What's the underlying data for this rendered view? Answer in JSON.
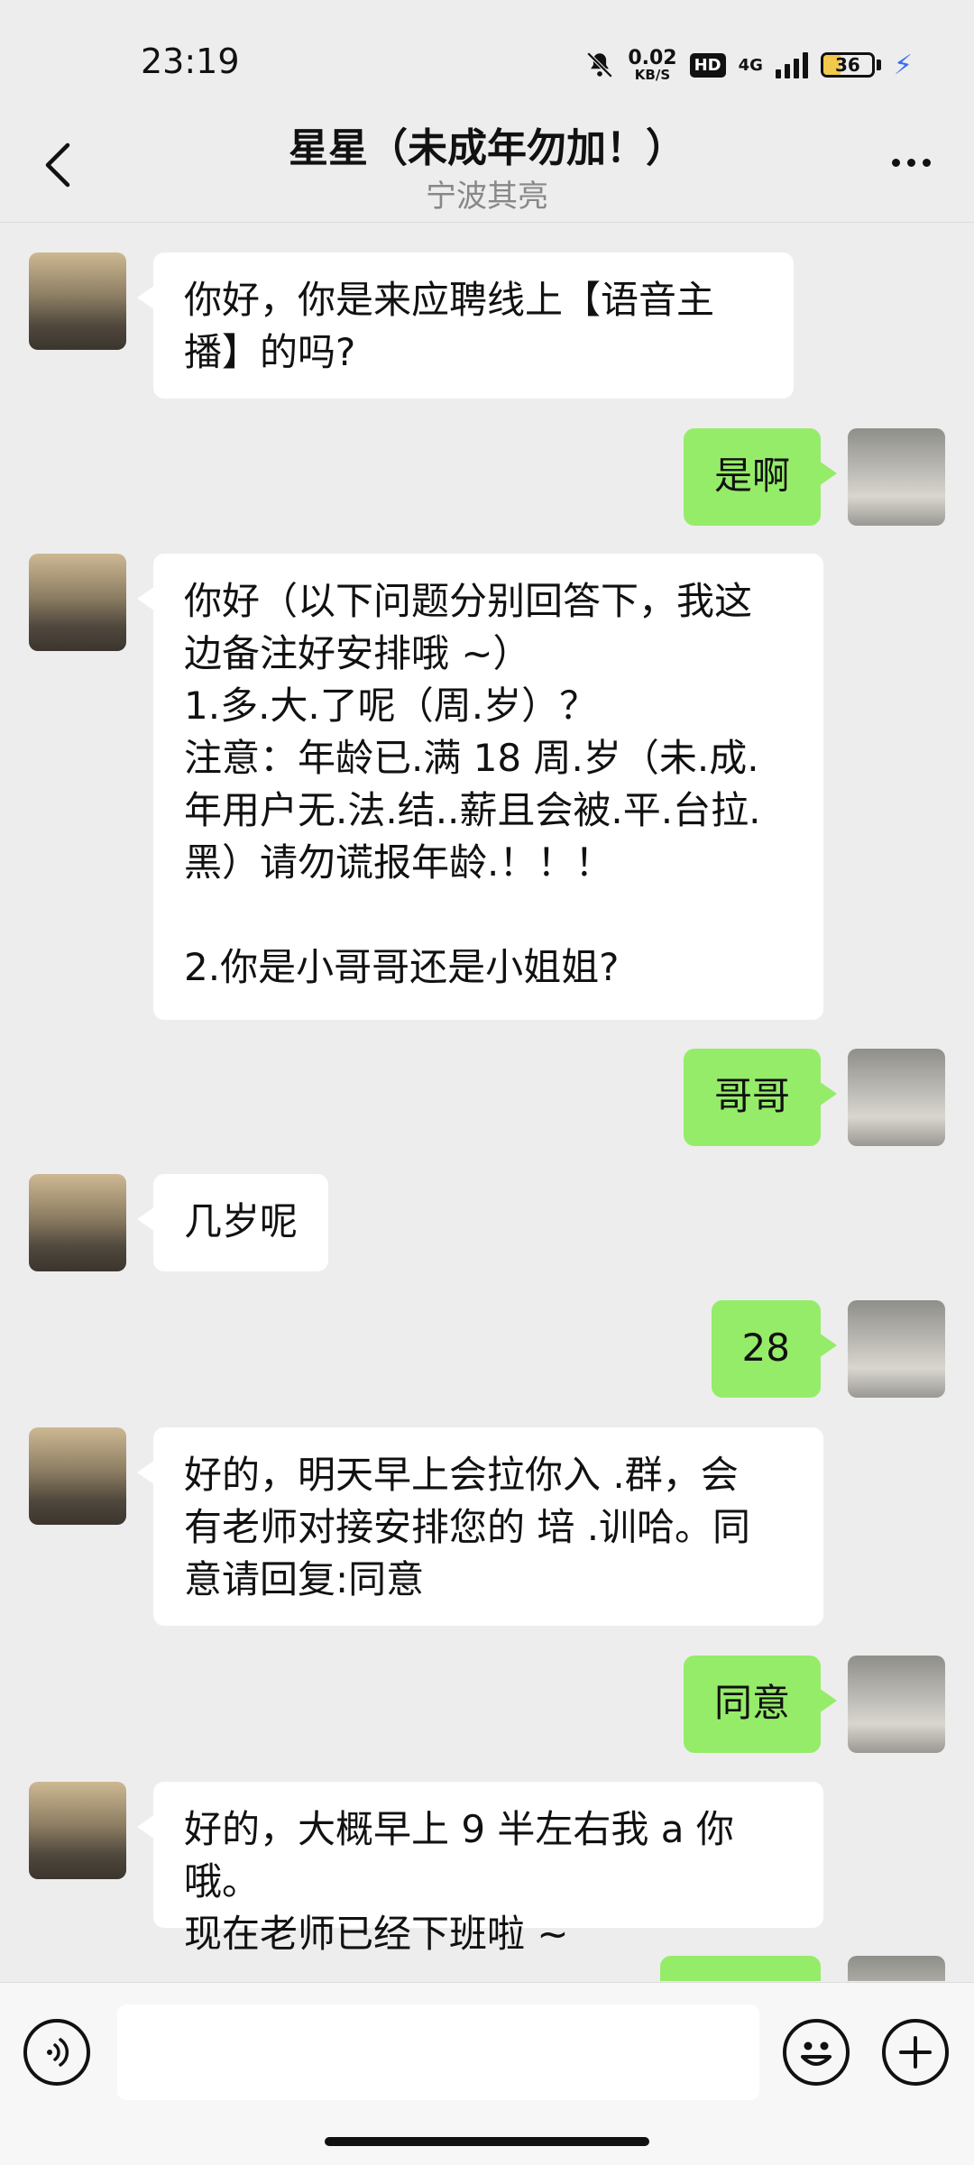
{
  "status_bar": {
    "time": "23:19",
    "net_speed_value": "0.02",
    "net_speed_unit": "KB/S",
    "hd_label": "HD",
    "network_label": "4G",
    "battery_level": "36",
    "icons": [
      "mute-bell-icon",
      "hd-icon",
      "signal-icon",
      "battery-icon",
      "charging-icon"
    ]
  },
  "header": {
    "title": "星星（未成年勿加！）",
    "subtitle": "宁波其亮",
    "back_icon": "chevron-left-icon",
    "more_icon": "more-dots-icon"
  },
  "messages": [
    {
      "side": "left",
      "text": "你好，你是来应聘线上【语音主\n播】的吗?"
    },
    {
      "side": "right",
      "text": "是啊"
    },
    {
      "side": "left",
      "text": "你好（以下问题分别回答下，我这\n边备注好安排哦 ~）\n1.多.大.了呢（周.岁）？\n注意：年龄已.满 18 周.岁（未.成.\n年用户无.法.结..薪且会被.平.台拉.\n黑）请勿谎报年龄.！！！\n\n2.你是小哥哥还是小姐姐?"
    },
    {
      "side": "right",
      "text": "哥哥"
    },
    {
      "side": "left",
      "text": "几岁呢"
    },
    {
      "side": "right",
      "text": "28"
    },
    {
      "side": "left",
      "text": "好的，明天早上会拉你入 .群，会\n有老师对接安排您的 培 .训哈。同\n意请回复:同意"
    },
    {
      "side": "right",
      "text": "同意"
    },
    {
      "side": "left",
      "text": "好的，大概早上 9 半左右我 a 你哦。\n现在老师已经下班啦 ~"
    },
    {
      "side": "right",
      "text": ""
    }
  ],
  "input_bar": {
    "voice_icon": "voice-icon",
    "text_value": "",
    "emoji_icon": "emoji-icon",
    "plus_icon": "plus-icon"
  },
  "colors": {
    "background": "#ededed",
    "incoming_bubble": "#ffffff",
    "outgoing_bubble": "#95ec69",
    "charging": "#3b6cf6"
  }
}
